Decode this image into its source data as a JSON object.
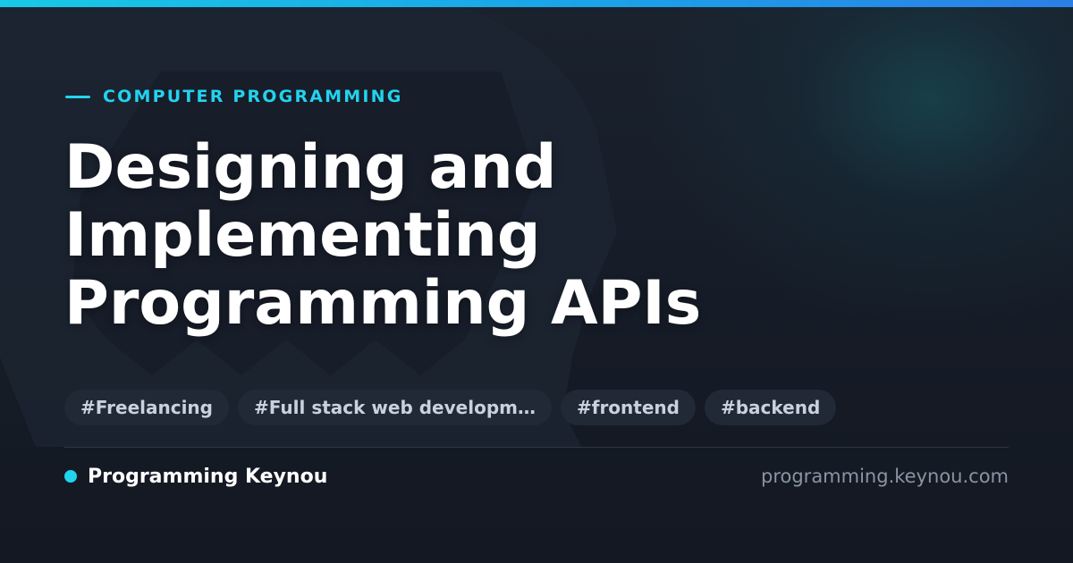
{
  "header": {
    "category": "COMPUTER PROGRAMMING",
    "title_lines": [
      "Designing and",
      "Implementing",
      "Programming APIs"
    ]
  },
  "tags": [
    "#Freelancing",
    "#Full stack web developm…",
    "#frontend",
    "#backend"
  ],
  "footer": {
    "brand": "Programming Keynou",
    "domain": "programming.keynou.com"
  },
  "colors": {
    "accent": "#22d3ee",
    "background": "#151a24",
    "tag_background": "#202935",
    "muted_text": "#8a94a3"
  }
}
